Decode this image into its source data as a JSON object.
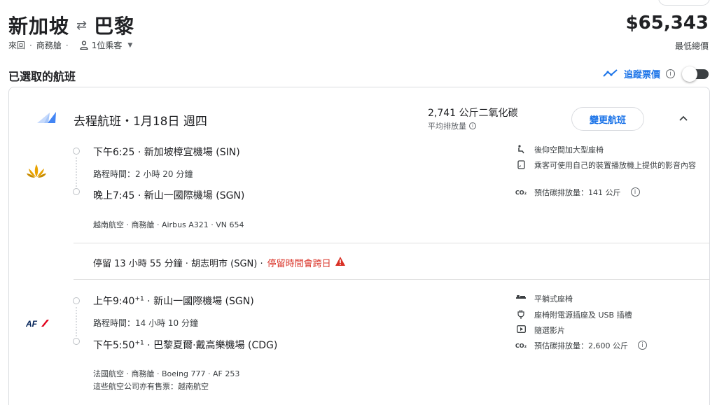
{
  "header": {
    "origin": "新加坡",
    "destination": "巴黎",
    "trip_type": "來回",
    "cabin": "商務艙",
    "passengers": "1位乘客",
    "price": "$65,343",
    "price_label": "最低總價"
  },
  "section": {
    "title": "已選取的航班",
    "track_label": "追蹤票價",
    "track_enabled": false
  },
  "outbound": {
    "title": "去程航班・1月18日 週四",
    "co2": "2,741 公斤二氧化碳",
    "co2_sub": "平均排放量",
    "change_button": "變更航班",
    "segments": [
      {
        "departure": "下午6:25 · 新加坡樟宜機場 (SIN)",
        "duration": "路程時間：2 小時 20 分鐘",
        "arrival": "晚上7:45 · 新山一國際機場 (SGN)",
        "meta": "越南航空 · 商務艙 · Airbus A321 · VN 654",
        "amenities": [
          {
            "icon": "legroom-icon",
            "text": "後仰空間加大型座椅"
          },
          {
            "icon": "device-stream-icon",
            "text": "乘客可使用自己的裝置播放機上提供的影音內容"
          },
          {
            "icon": "co2-icon",
            "text": "預估碳排放量：141 公斤"
          }
        ]
      },
      {
        "departure_time": "上午9:40",
        "departure_plus": "+1",
        "departure_place": " · 新山一國際機場 (SGN)",
        "duration": "路程時間：14 小時 10 分鐘",
        "arrival_time": "下午5:50",
        "arrival_plus": "+1",
        "arrival_place": " · 巴黎夏爾·戴高樂機場 (CDG)",
        "meta": "法國航空 · 商務艙 · Boeing 777 · AF 253",
        "meta2": "這些航空公司亦有售票：越南航空",
        "amenities": [
          {
            "icon": "flat-bed-icon",
            "text": "平躺式座椅"
          },
          {
            "icon": "power-outlet-icon",
            "text": "座椅附電源插座及 USB 插槽"
          },
          {
            "icon": "video-icon",
            "text": "隨選影片"
          },
          {
            "icon": "co2-icon",
            "text": "預估碳排放量：2,600 公斤"
          }
        ]
      }
    ],
    "layover": "停留 13 小時 55 分鐘 · 胡志明市 (SGN) · ",
    "layover_warning": "停留時間會跨日"
  },
  "colors": {
    "accent": "#1a73e8",
    "warning": "#d93025"
  }
}
